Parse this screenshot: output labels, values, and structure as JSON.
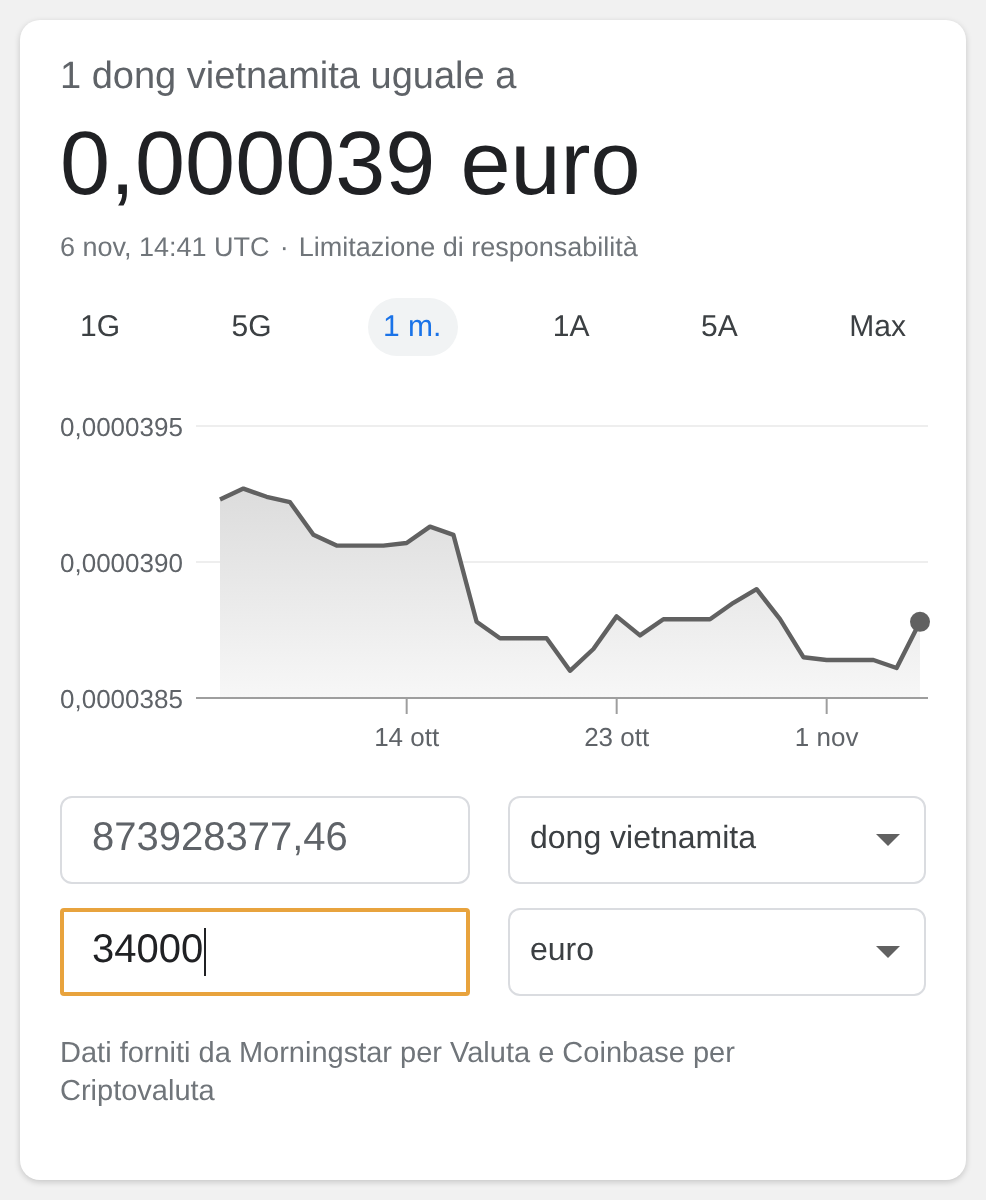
{
  "header": {
    "subtitle": "1 dong vietnamita uguale a",
    "rate": "0,000039 euro",
    "timestamp": "6 nov, 14:41 UTC",
    "separator": "·",
    "disclaimer_link": "Limitazione di responsabilità"
  },
  "ranges": [
    {
      "label": "1G",
      "selected": false
    },
    {
      "label": "5G",
      "selected": false
    },
    {
      "label": "1 m.",
      "selected": true
    },
    {
      "label": "1A",
      "selected": false
    },
    {
      "label": "5A",
      "selected": false
    },
    {
      "label": "Max",
      "selected": false
    }
  ],
  "chart": {
    "chart_data": {
      "type": "area",
      "categories": [
        null,
        null,
        null,
        null,
        null,
        null,
        null,
        null,
        "14 ott",
        null,
        null,
        null,
        null,
        null,
        null,
        null,
        null,
        "23 ott",
        null,
        null,
        null,
        null,
        null,
        null,
        null,
        null,
        "1 nov",
        null,
        null,
        null,
        null
      ],
      "series": [
        {
          "color": "#616161",
          "values": [
            3.923e-05,
            3.927e-05,
            3.924e-05,
            3.922e-05,
            3.91e-05,
            3.906e-05,
            3.906e-05,
            3.906e-05,
            3.907e-05,
            3.913e-05,
            3.91e-05,
            3.878e-05,
            3.872e-05,
            3.872e-05,
            3.872e-05,
            3.86e-05,
            3.868e-05,
            3.88e-05,
            3.873e-05,
            3.879e-05,
            3.879e-05,
            3.879e-05,
            3.885e-05,
            3.89e-05,
            3.879e-05,
            3.865e-05,
            3.864e-05,
            3.864e-05,
            3.864e-05,
            3.861e-05,
            3.878e-05
          ]
        }
      ],
      "ylim": [
        3.85e-05,
        3.95e-05
      ],
      "yticks": [
        {
          "value": 3.95e-05,
          "label": "0,0000395"
        },
        {
          "value": 3.9e-05,
          "label": "0,0000390"
        },
        {
          "value": 3.85e-05,
          "label": "0,0000385"
        }
      ]
    }
  },
  "converter": [
    {
      "amount": "873928377,46",
      "currency": "dong vietnamita",
      "focused": false
    },
    {
      "amount": "34000",
      "currency": "euro",
      "focused": true
    }
  ],
  "footer": "Dati forniti da Morningstar per Valuta e Coinbase per Criptovaluta"
}
